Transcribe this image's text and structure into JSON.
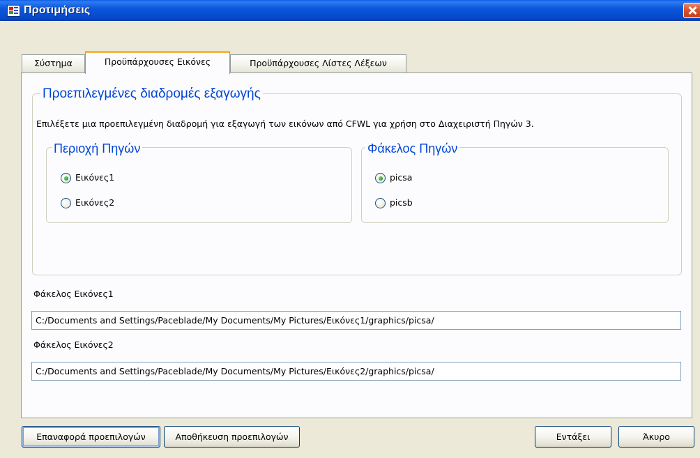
{
  "window": {
    "title": "Προτιμήσεις"
  },
  "tabs": [
    {
      "label": "Σύστημα",
      "active": false
    },
    {
      "label": "Προϋπάρχουσες Εικόνες",
      "active": true
    },
    {
      "label": "Προϋπάρχουσες Λίστες Λέξεων",
      "active": false
    }
  ],
  "export_group": {
    "title": "Προεπιλεγμένες διαδρομές εξαγωγής",
    "description": "Επιλέξετε μια προεπιλεγμένη διαδρομή για εξαγωγή των εικόνων από CFWL για χρήση στο Διαχειριστή Πηγών 3."
  },
  "source_area": {
    "title": "Περιοχή Πηγών",
    "options": [
      {
        "label": "Εικόνες1",
        "checked": true
      },
      {
        "label": "Εικόνες2",
        "checked": false
      }
    ]
  },
  "source_folder": {
    "title": "Φάκελος Πηγών",
    "options": [
      {
        "label": "picsa",
        "checked": true
      },
      {
        "label": "picsb",
        "checked": false
      }
    ]
  },
  "folders": [
    {
      "label": "Φάκελος Εικόνες1",
      "value": "C:/Documents and Settings/Paceblade/My Documents/My Pictures/Εικόνες1/graphics/picsa/"
    },
    {
      "label": "Φάκελος Εικόνες2",
      "value": "C:/Documents and Settings/Paceblade/My Documents/My Pictures/Εικόνες2/graphics/picsa/"
    }
  ],
  "buttons": {
    "reset_defaults": "Επαναφορά προεπιλογών",
    "save_defaults": "Αποθήκευση προεπιλογών",
    "ok": "Εντάξει",
    "cancel": "Άκυρο"
  },
  "colors": {
    "titlebar": "#0b57dc",
    "dialog_bg": "#ece9d8",
    "group_title": "#0046d5",
    "active_tab_highlight": "#f5b642",
    "radio_checked": "#21a121"
  }
}
